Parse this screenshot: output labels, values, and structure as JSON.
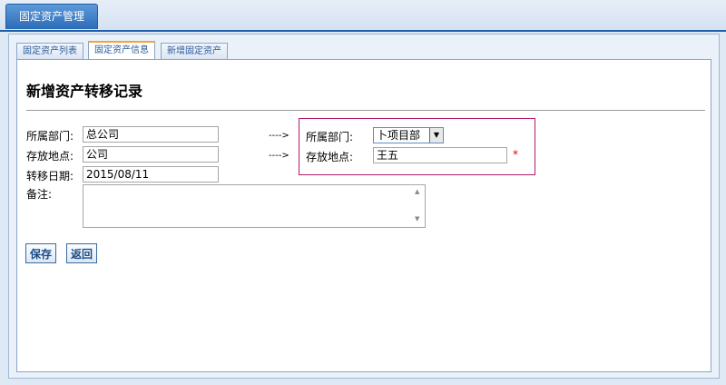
{
  "module_tab": "固定资产管理",
  "subtabs": [
    "固定资产列表",
    "固定资产信息",
    "新增固定资产"
  ],
  "form": {
    "title": "新增资产转移记录",
    "dept_label": "所属部门:",
    "dept_value": "总公司",
    "location_label": "存放地点:",
    "location_value": "公司",
    "date_label": "转移日期:",
    "date_value": "2015/08/11",
    "note_label": "备注:",
    "arrow": "---->",
    "new_dept_label": "所属部门:",
    "new_dept_value": "卜项目部",
    "new_location_label": "存放地点:",
    "new_location_value": "王五",
    "required_mark": "*"
  },
  "buttons": {
    "save": "保存",
    "back": "返回"
  },
  "colors": {
    "accent": "#2c6cb8",
    "highlight_border": "#b0196a",
    "active_tab": "#f2a33a"
  }
}
